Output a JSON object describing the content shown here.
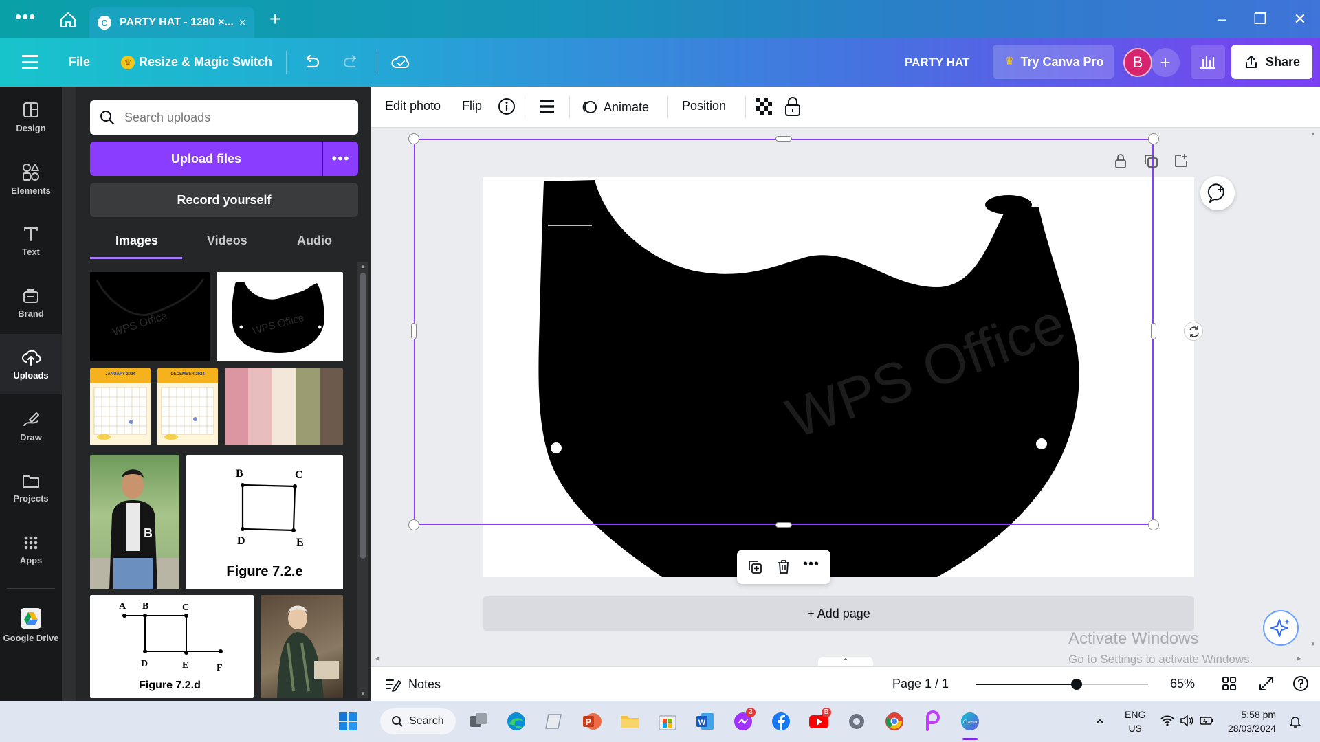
{
  "browser": {
    "tab_title": "PARTY HAT - 1280 ×...",
    "tab_favicon_letter": "C",
    "new_tab_symbol": "+",
    "close_symbol": "×",
    "window_controls": {
      "minimize": "–",
      "restore": "❐",
      "close": "✕"
    }
  },
  "topbar": {
    "file_label": "File",
    "resize_label": "Resize & Magic Switch",
    "design_title": "PARTY HAT",
    "try_pro_label": "Try Canva Pro",
    "avatar_letter": "B",
    "add_label": "+",
    "share_label": "Share"
  },
  "rail": {
    "items": [
      {
        "label": "Design",
        "icon": "layout-icon"
      },
      {
        "label": "Elements",
        "icon": "shapes-icon"
      },
      {
        "label": "Text",
        "icon": "text-icon"
      },
      {
        "label": "Brand",
        "icon": "brand-icon"
      },
      {
        "label": "Uploads",
        "icon": "cloud-upload-icon",
        "active": true
      },
      {
        "label": "Draw",
        "icon": "draw-icon"
      },
      {
        "label": "Projects",
        "icon": "folder-icon"
      },
      {
        "label": "Apps",
        "icon": "apps-grid-icon"
      },
      {
        "label": "Google Drive",
        "icon": "google-drive-icon"
      }
    ]
  },
  "panel": {
    "search_placeholder": "Search uploads",
    "upload_label": "Upload files",
    "upload_more": "•••",
    "record_label": "Record yourself",
    "tabs": [
      "Images",
      "Videos",
      "Audio"
    ],
    "active_tab": "Images",
    "thumbs": {
      "watermark_1": "WPS Office",
      "watermark_2": "WPS Office",
      "cal1_header": "JANUARY 2024",
      "cal2_header": "DECEMBER 2024",
      "fig1_B": "B",
      "fig1_C": "C",
      "fig1_D": "D",
      "fig1_E": "E",
      "fig1_caption": "Figure 7.2.e",
      "fig2_A": "A",
      "fig2_B": "B",
      "fig2_C": "C",
      "fig2_D": "D",
      "fig2_E": "E",
      "fig2_F": "F",
      "fig2_caption": "Figure 7.2.d"
    },
    "palette": [
      "#dc96a2",
      "#e9bcbe",
      "#f3e7da",
      "#9c9c72",
      "#6c5a4c"
    ]
  },
  "context_toolbar": {
    "edit_photo": "Edit photo",
    "flip": "Flip",
    "animate": "Animate",
    "position": "Position"
  },
  "canvas": {
    "watermark_text": "WPS Office",
    "add_page_label": "+ Add page"
  },
  "activate_windows": {
    "line1": "Activate Windows",
    "line2": "Go to Settings to activate Windows."
  },
  "statusbar": {
    "notes_label": "Notes",
    "page_info": "Page 1 / 1",
    "zoom_percent": 65,
    "zoom_label": "65%"
  },
  "taskbar": {
    "search_label": "Search",
    "messenger_badge": "3",
    "youtube_badge": "B",
    "lang_line1": "ENG",
    "lang_line2": "US",
    "time": "5:58 pm",
    "date": "28/03/2024"
  },
  "colors": {
    "accent": "#8b3dff",
    "rail_bg": "#18191b",
    "panel_bg": "#252627"
  }
}
